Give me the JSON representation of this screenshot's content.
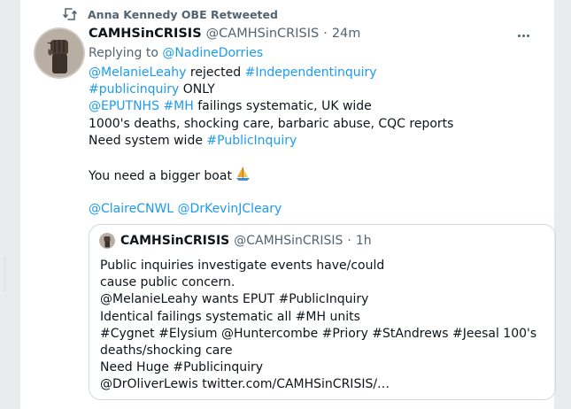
{
  "retweet": {
    "label": "Anna Kennedy OBE Retweeted"
  },
  "tweet": {
    "name": "CAMHSinCRISIS",
    "handle": "@CAMHSinCRISIS",
    "sep": "·",
    "time": "24m",
    "reply_prefix": "Replying to",
    "reply_to": "@NadineDorries",
    "body": {
      "l1_mention": "@MelanieLeahy",
      "l1_text": " rejected ",
      "l1_tag": "#Independentinquiry",
      "l2_tag": "#publicinquiry",
      "l2_text": " ONLY",
      "l3_mention": "@EPUTNHS",
      "l3_tag": "#MH",
      "l3_text": " failings systematic, UK wide",
      "l4_text": "1000's deaths, shocking care, barbaric abuse, CQC reports",
      "l5_text": "Need system wide ",
      "l5_tag": "#PublicInquiry",
      "l6_text": "You need a bigger boat",
      "l7_mention1": "@ClaireCNWL",
      "l7_mention2": "@DrKevinJCleary"
    }
  },
  "quote": {
    "name": "CAMHSinCRISIS",
    "handle": "@CAMHSinCRISIS",
    "sep": "·",
    "time": "1h",
    "lines": [
      "Public inquiries investigate events have/could",
      "cause public concern.",
      "@MelanieLeahy wants EPUT #PublicInquiry",
      "Identical failings systematic all #MH units",
      "#Cygnet #Elysium @Huntercombe #Priory #StAndrews #Jeesal 100's",
      "deaths/shocking care",
      "Need Huge #Publicinquiry",
      "@DrOliverLewis twitter.com/CAMHSinCRISIS/…"
    ]
  },
  "colors": {
    "link": "#1d9bf0",
    "secondary": "#536471",
    "text": "#0f1419"
  },
  "icons": [
    "retweet-icon",
    "fist-avatar",
    "more-icon",
    "sailboat-emoji"
  ]
}
